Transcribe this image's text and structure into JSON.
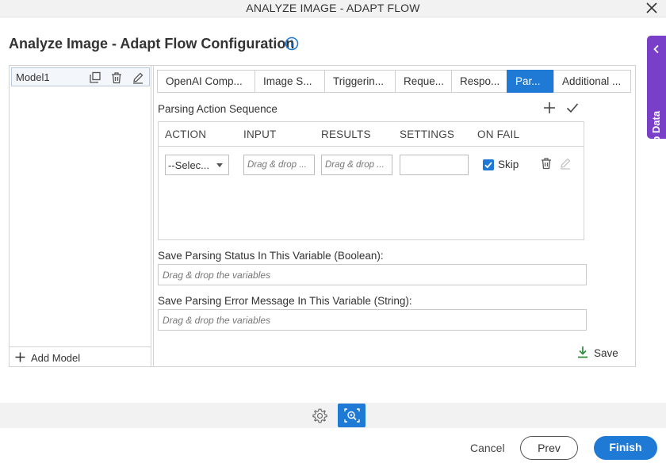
{
  "window": {
    "title": "ANALYZE IMAGE - ADAPT FLOW",
    "close_icon": "close-icon"
  },
  "page": {
    "title": "Analyze Image - Adapt Flow Configuration",
    "info_icon": "info-icon"
  },
  "app_data_tab": {
    "label": "App Data",
    "icon": "chevron-left-icon",
    "color": "#7a3fc8"
  },
  "models": {
    "items": [
      {
        "name": "Model1",
        "icons": [
          "copy-icon",
          "delete-icon",
          "edit-icon"
        ]
      }
    ],
    "add_label": "Add Model"
  },
  "tabs": [
    {
      "label": "OpenAI Comp...",
      "active": false
    },
    {
      "label": "Image S...",
      "active": false
    },
    {
      "label": "Triggerin...",
      "active": false
    },
    {
      "label": "Reque...",
      "active": false
    },
    {
      "label": "Respo...",
      "active": false
    },
    {
      "label": "Par...",
      "active": true
    },
    {
      "label": "Additional ...",
      "active": false
    }
  ],
  "parsing": {
    "title": "Parsing Action Sequence",
    "columns": [
      "ACTION",
      "INPUT",
      "RESULTS",
      "SETTINGS",
      "ON FAIL"
    ],
    "row": {
      "action_value": "--Selec...",
      "input_placeholder": "Drag & drop ...",
      "results_placeholder": "Drag & drop ...",
      "settings_value": "",
      "on_fail_checked": true,
      "on_fail_label": "Skip"
    }
  },
  "status_variable": {
    "label": "Save Parsing Status In This Variable (Boolean):",
    "placeholder": "Drag & drop the variables"
  },
  "error_variable": {
    "label": "Save Parsing Error Message In This Variable (String):",
    "placeholder": "Drag & drop the variables"
  },
  "save_label": "Save",
  "footer": {
    "cancel": "Cancel",
    "prev": "Prev",
    "finish": "Finish",
    "accent": "#1f7ad6"
  }
}
